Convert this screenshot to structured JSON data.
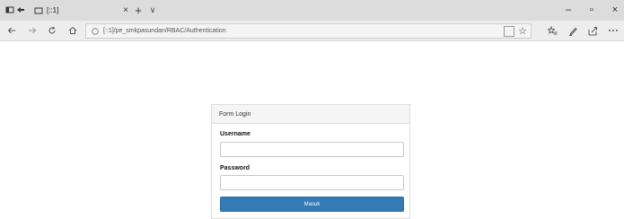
{
  "browser": {
    "tab": {
      "title": "[::1]",
      "close_glyph": "×"
    },
    "new_tab_glyph": "+",
    "tabs_menu_glyph": "∨",
    "window_controls": {
      "minimize": "–",
      "maximize": "▫",
      "close": "×"
    },
    "address_bar": {
      "url": "[::1]/pe_smkpasundan/RBAC/Authentication"
    },
    "icons": {
      "tab_aside": "tab-aside-icon",
      "back_tabs": "back-tabs-icon",
      "tab_page": "page-icon",
      "back": "back-arrow-icon",
      "forward": "forward-arrow-icon",
      "refresh": "refresh-icon",
      "home": "home-icon",
      "site_info": "info-icon",
      "reading_view": "reading-view-icon",
      "favorite": "star-icon",
      "favorites_hub": "favorites-hub-icon",
      "notes": "pen-icon",
      "share": "share-icon",
      "more": "more-icon"
    }
  },
  "login_form": {
    "heading": "Form Login",
    "username_label": "Username",
    "username_value": "",
    "password_label": "Password",
    "password_value": "",
    "submit_label": "Masuk"
  },
  "colors": {
    "tabbar_bg": "#dcdcdc",
    "navbar_bg": "#ededed",
    "panel_heading_bg": "#f5f5f5",
    "button_primary": "#337ab7"
  }
}
